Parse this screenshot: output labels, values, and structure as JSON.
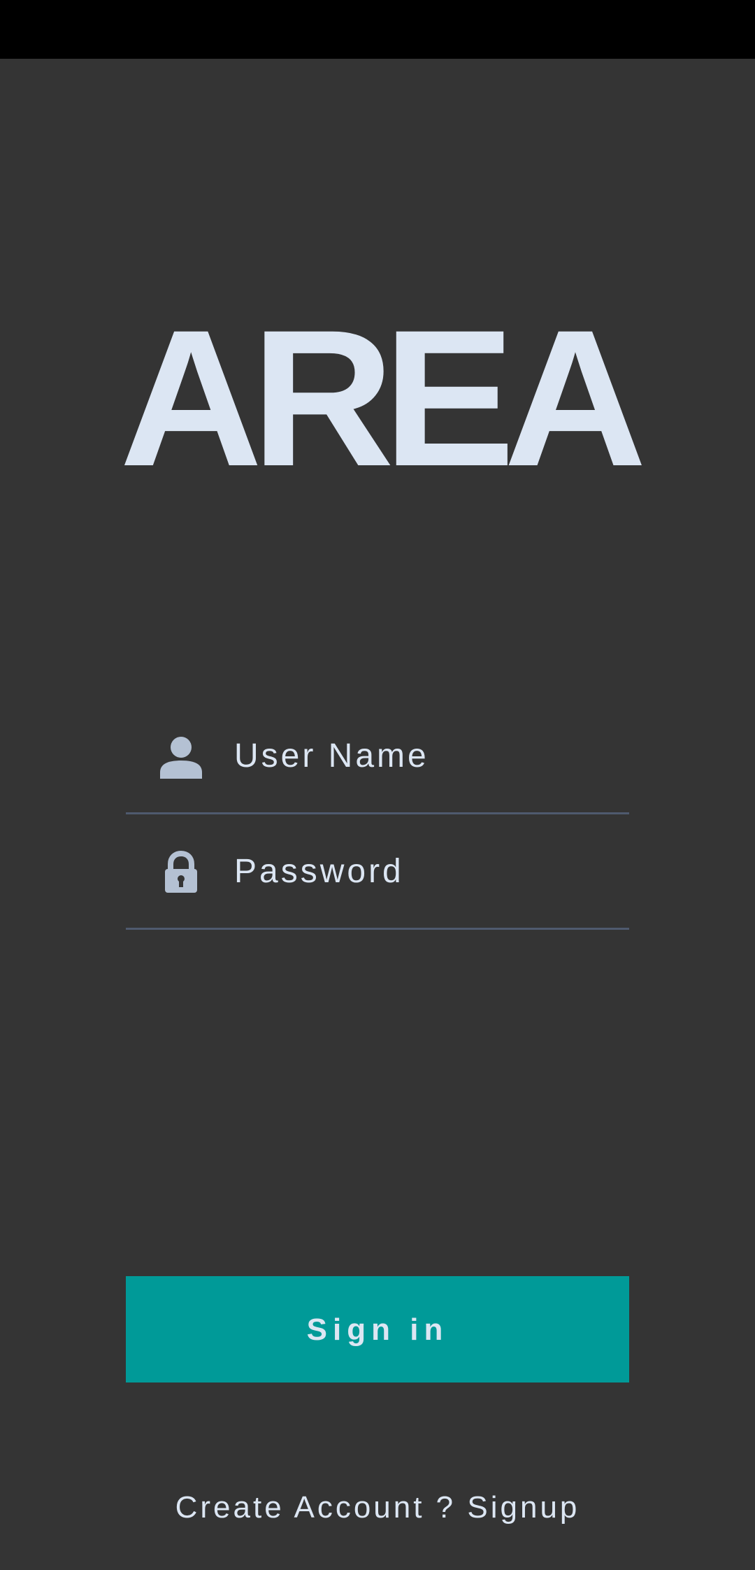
{
  "app": {
    "logo_text": "AREA"
  },
  "form": {
    "username": {
      "placeholder": "User Name",
      "icon": "person-icon"
    },
    "password": {
      "placeholder": "Password",
      "icon": "lock-icon"
    }
  },
  "actions": {
    "signin_label": "Sign in",
    "signup_link": "Create Account ? Signup"
  },
  "colors": {
    "background": "#343434",
    "status_bar": "#000000",
    "text": "#dce6f3",
    "icon": "#b4c1d3",
    "divider": "#4f5a6e",
    "accent": "#009a98"
  }
}
